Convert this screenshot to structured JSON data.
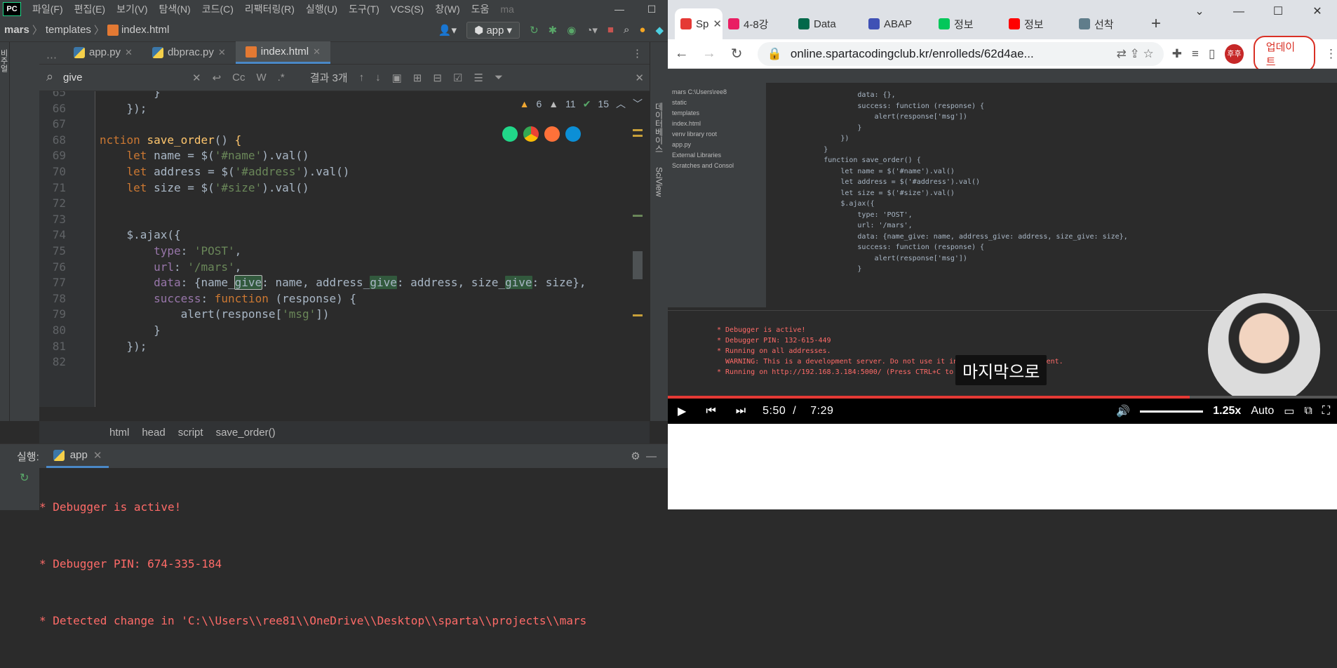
{
  "ide": {
    "menu": [
      "파일(F)",
      "편집(E)",
      "보기(V)",
      "탐색(N)",
      "코드(C)",
      "리팩터링(R)",
      "실행(U)",
      "도구(T)",
      "VCS(S)",
      "창(W)",
      "도움",
      "ma"
    ],
    "nav": {
      "project": "mars",
      "folder": "templates",
      "file": "index.html",
      "run_config": "app"
    },
    "tabs": [
      {
        "label": "app.py",
        "icon": "python-icon"
      },
      {
        "label": "dbprac.py",
        "icon": "python-icon"
      },
      {
        "label": "index.html",
        "icon": "html-icon",
        "active": true
      }
    ],
    "search": {
      "query": "give",
      "result": "결과 3개",
      "opts": [
        "Cc",
        "W",
        ".*"
      ]
    },
    "inspections": {
      "warnings": "6",
      "weak": "11",
      "ok": "15"
    },
    "lines": [
      {
        "n": "65",
        "html": "        <span class='def'>}</span>"
      },
      {
        "n": "66",
        "html": "    <span class='def'>});</span>"
      },
      {
        "n": "67",
        "html": ""
      },
      {
        "n": "68",
        "html": "<span class='kw'>nction</span> <span class='fn'>save_order</span>() <span class='fn'>{</span>"
      },
      {
        "n": "69",
        "html": "    <span class='kw'>let</span> name = $(<span class='str'>'#name'</span>).val()"
      },
      {
        "n": "70",
        "html": "    <span class='kw'>let</span> address = $(<span class='str'>'#address'</span>).val()"
      },
      {
        "n": "71",
        "html": "    <span class='kw'>let</span> size = $(<span class='str'>'#size'</span>).val()"
      },
      {
        "n": "72",
        "html": ""
      },
      {
        "n": "73",
        "html": ""
      },
      {
        "n": "74",
        "html": "    $.ajax({"
      },
      {
        "n": "75",
        "html": "        <span class='prop'>type</span>: <span class='str'>'POST'</span>,"
      },
      {
        "n": "76",
        "html": "        <span class='prop'>url</span>: <span class='str'>'/mars'</span>,"
      },
      {
        "n": "77",
        "html": "        <span class='prop'>data</span>: {name_<span class='hl hlb'>give</span>: name, address_<span class='hl'>give</span>: address, size_<span class='hl'>give</span>: size},"
      },
      {
        "n": "78",
        "html": "        <span class='prop'>success</span>: <span class='kw'>function</span> (response) {"
      },
      {
        "n": "79",
        "html": "            alert(response[<span class='str'>'msg'</span>])"
      },
      {
        "n": "80",
        "html": "        }"
      },
      {
        "n": "81",
        "html": "    });"
      },
      {
        "n": "82",
        "html": ""
      }
    ],
    "right_tools": [
      "데이터베이스",
      "SciView"
    ],
    "left_tools": "비주얼",
    "breadcrumbs": [
      "html",
      "head",
      "script",
      "save_order()"
    ],
    "run": {
      "label": "실행:",
      "tab": "app",
      "output": [
        "* Debugger is active!",
        "* Debugger PIN: 674-335-184",
        "* Detected change in 'C:\\\\Users\\\\ree81\\\\OneDrive\\\\Desktop\\\\sparta\\\\projects\\\\mars"
      ]
    }
  },
  "browser": {
    "tabs": [
      {
        "label": "Sp",
        "color": "#e53935",
        "active": true
      },
      {
        "label": "4-8강",
        "color": "#e91e63"
      },
      {
        "label": "Data",
        "color": "#00684a"
      },
      {
        "label": "ABAP",
        "color": "#3f51b5"
      },
      {
        "label": "정보",
        "color": "#03c75a"
      },
      {
        "label": "정보",
        "color": "#ff0000"
      },
      {
        "label": "선착",
        "color": "#607d8b"
      }
    ],
    "url": "online.spartacodingclub.kr/enrolleds/62d4ae...",
    "avatar": "후후",
    "update": "업데이트",
    "video": {
      "subtitle": "마지막으로",
      "current": "5:50",
      "sep": "/",
      "duration": "7:29",
      "progress": 0.78,
      "speed": "1.25x",
      "quality": "Auto",
      "code": [
        "                    data: {},",
        "                    success: function (response) {",
        "                        alert(response['msg'])",
        "                    }",
        "                })",
        "            }",
        "            function save_order() {",
        "                let name = $('#name').val()",
        "                let address = $('#address').val()",
        "                let size = $('#size').val()",
        "",
        "                $.ajax({",
        "                    type: 'POST',",
        "                    url: '/mars',",
        "                    data: {name_give: name, address_give: address, size_give: size},",
        "                    success: function (response) {",
        "                        alert(response['msg'])",
        "                    }"
      ],
      "run": [
        "* Debugger is active!",
        "* Debugger PIN: 132-615-449",
        "* Running on all addresses.",
        "  WARNING: This is a development server. Do not use it in a production deployment.",
        "* Running on http://192.168.3.184:5000/ (Press CTRL+C to"
      ],
      "tree": [
        "mars  C:\\Users\\ree8",
        "  static",
        "  templates",
        "    index.html",
        "  venv  library root",
        "  app.py",
        "External Libraries",
        "Scratches and Consol"
      ]
    }
  }
}
